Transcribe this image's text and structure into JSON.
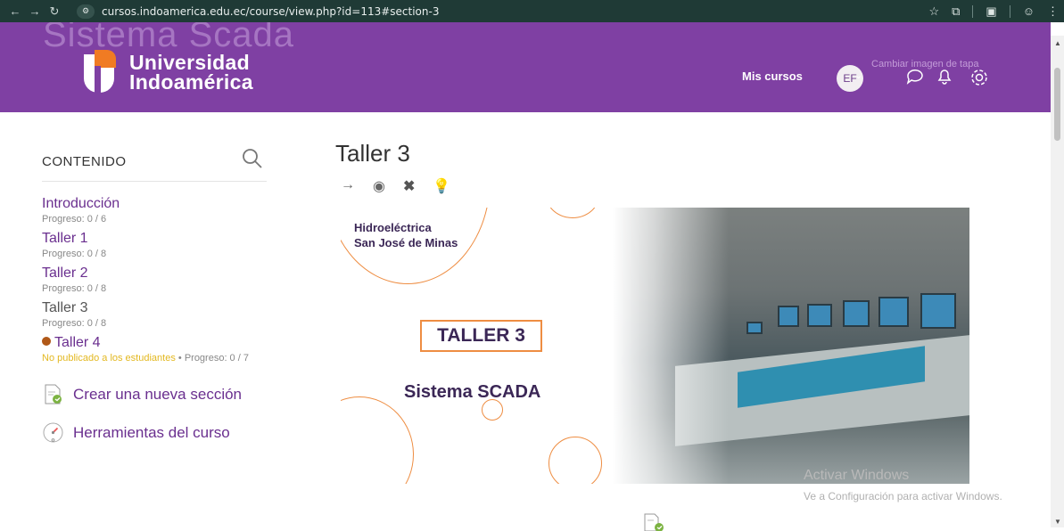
{
  "browser": {
    "url": "cursos.indoamerica.edu.ec/course/view.php?id=113#section-3",
    "site_icon": "tune-icon"
  },
  "header": {
    "ghost_title": "Sistema Scada",
    "logo_line1": "Universidad",
    "logo_line2": "Indoamérica",
    "nav_mis_cursos": "Mis cursos",
    "avatar_initials": "EF",
    "change_image": "Cambiar imagen de tapa",
    "colors": {
      "brand_purple": "#7f40a3",
      "accent_orange": "#f07b23"
    }
  },
  "sidebar": {
    "title": "CONTENIDO",
    "sections": [
      {
        "name": "Introducción",
        "progress": "Progreso: 0 / 6"
      },
      {
        "name": "Taller 1",
        "progress": "Progreso: 0 / 8"
      },
      {
        "name": "Taller 2",
        "progress": "Progreso: 0 / 8"
      },
      {
        "name": "Taller 3",
        "progress": "Progreso: 0 / 8"
      },
      {
        "name": "Taller 4",
        "status": "No publicado a los estudiantes",
        "sep": "•",
        "progress": "Progreso: 0 / 7"
      }
    ],
    "actions": [
      {
        "label": "Crear una nueva sección",
        "icon": "new-page-icon"
      },
      {
        "label": "Herramientas del curso",
        "icon": "gauge-icon"
      }
    ]
  },
  "main": {
    "section_title": "Taller 3",
    "tools": [
      "move-icon",
      "eye-icon",
      "delete-icon",
      "highlight-icon"
    ],
    "banner": {
      "hidro_line1": "Hidroeléctrica",
      "hidro_line2": "San José de Minas",
      "taller_label": "TALLER 3",
      "scada_label": "Sistema SCADA"
    }
  },
  "watermark": {
    "line1": "Activar Windows",
    "line2": "Ve a Configuración para activar Windows."
  }
}
